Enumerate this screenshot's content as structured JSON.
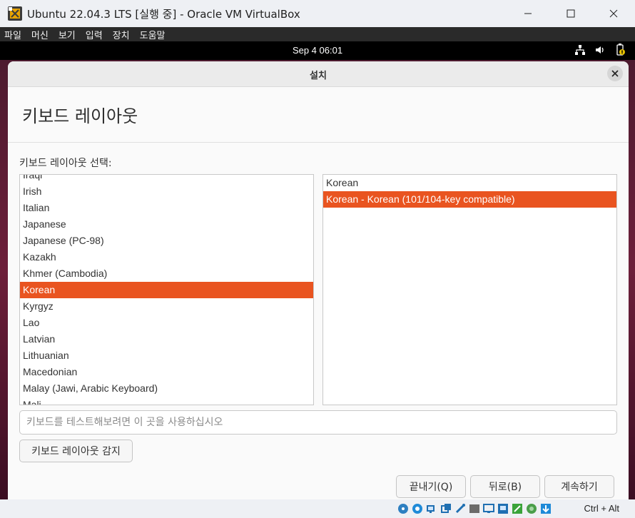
{
  "host_window": {
    "title": "Ubuntu 22.04.3 LTS [실행 중] - Oracle VM VirtualBox",
    "controls": {
      "minimize_icon": "minimize-icon",
      "maximize_icon": "maximize-icon",
      "close_icon": "close-icon"
    }
  },
  "host_menu": [
    {
      "label": "파일"
    },
    {
      "label": "머신"
    },
    {
      "label": "보기"
    },
    {
      "label": "입력"
    },
    {
      "label": "장치"
    },
    {
      "label": "도움말"
    }
  ],
  "guest_topbar": {
    "clock": "Sep 4  06:01",
    "tray_icons": [
      "network-icon",
      "volume-icon",
      "battery-icon"
    ]
  },
  "installer": {
    "window_title": "설치",
    "page_heading": "키보드 레이아웃",
    "select_label": "키보드 레이아웃 선택:",
    "layouts": [
      {
        "label": "Iraqi",
        "selected": false
      },
      {
        "label": "Irish",
        "selected": false
      },
      {
        "label": "Italian",
        "selected": false
      },
      {
        "label": "Japanese",
        "selected": false
      },
      {
        "label": "Japanese (PC-98)",
        "selected": false
      },
      {
        "label": "Kazakh",
        "selected": false
      },
      {
        "label": "Khmer (Cambodia)",
        "selected": false
      },
      {
        "label": "Korean",
        "selected": true
      },
      {
        "label": "Kyrgyz",
        "selected": false
      },
      {
        "label": "Lao",
        "selected": false
      },
      {
        "label": "Latvian",
        "selected": false
      },
      {
        "label": "Lithuanian",
        "selected": false
      },
      {
        "label": "Macedonian",
        "selected": false
      },
      {
        "label": "Malay (Jawi, Arabic Keyboard)",
        "selected": false
      },
      {
        "label": "Mali",
        "selected": false
      }
    ],
    "variants": [
      {
        "label": "Korean",
        "selected": false
      },
      {
        "label": "Korean - Korean (101/104-key compatible)",
        "selected": true
      }
    ],
    "test_placeholder": "키보드를 테스트해보려면 이 곳을 사용하십시오",
    "test_value": "",
    "detect_button": "키보드 레이아웃 감지",
    "quit_button": "끝내기(Q)",
    "back_button": "뒤로(B)",
    "continue_button": "계속하기",
    "accent_color": "#e95420"
  },
  "host_statusbar": {
    "icons": [
      "optical-drive-icon",
      "audio-icon",
      "network-icon",
      "usb-icon",
      "shared-folders-icon",
      "display-icon",
      "recording-icon",
      "capture-icon",
      "mouse-integration-icon",
      "cpu-icon",
      "keyboard-download-icon"
    ],
    "host_key": "Ctrl + Alt"
  }
}
